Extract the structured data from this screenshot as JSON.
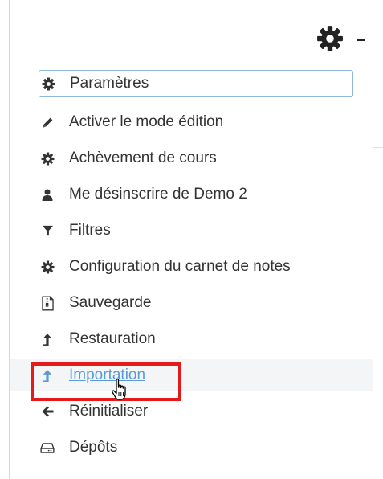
{
  "menu": {
    "trigger": {
      "icon": "gear-icon",
      "caret_icon": "caret-down-icon"
    },
    "items": [
      {
        "label": "Paramètres",
        "icon": "gear-icon",
        "state": "focused"
      },
      {
        "label": "Activer le mode édition",
        "icon": "pencil-icon",
        "state": "normal"
      },
      {
        "label": "Achèvement de cours",
        "icon": "gear-icon",
        "state": "normal"
      },
      {
        "label": "Me désinscrire de Demo 2",
        "icon": "user-icon",
        "state": "normal"
      },
      {
        "label": "Filtres",
        "icon": "filter-icon",
        "state": "normal"
      },
      {
        "label": "Configuration du carnet de notes",
        "icon": "gear-icon",
        "state": "normal"
      },
      {
        "label": "Sauvegarde",
        "icon": "archive-file-icon",
        "state": "normal"
      },
      {
        "label": "Restauration",
        "icon": "upload-arrow-icon",
        "state": "normal"
      },
      {
        "label": "Importation",
        "icon": "upload-arrow-icon",
        "state": "hover"
      },
      {
        "label": "Réinitialiser",
        "icon": "arrow-left-icon",
        "state": "normal"
      },
      {
        "label": "Dépôts",
        "icon": "drive-icon",
        "state": "normal"
      }
    ]
  },
  "annotation": {
    "highlight_color": "#e31b1b",
    "target": "Importation"
  },
  "colors": {
    "text": "#333333",
    "link_hover": "#5b9bd5",
    "focus_border": "#8fb6dc"
  }
}
